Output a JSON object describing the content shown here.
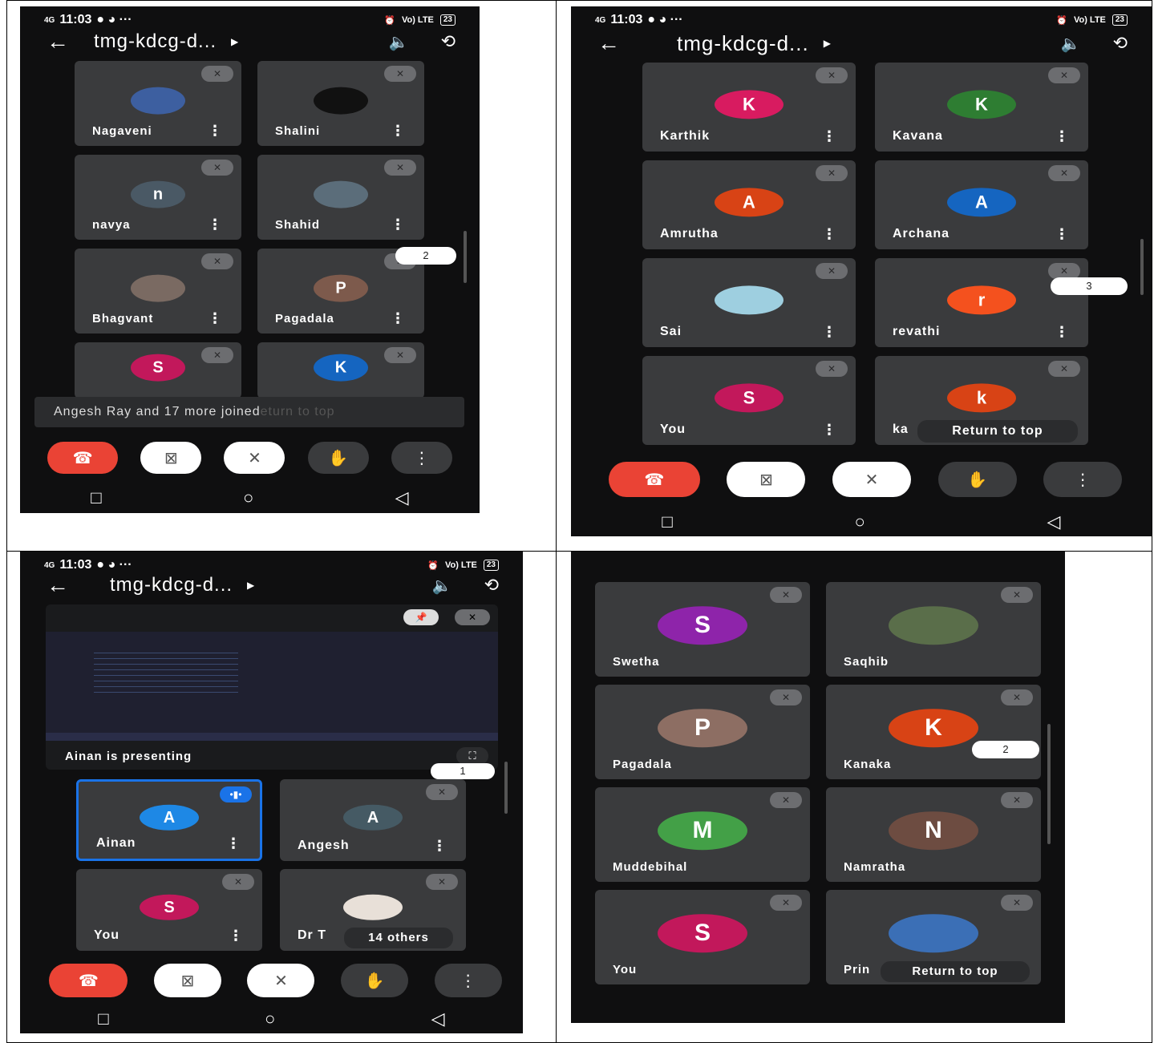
{
  "status": {
    "time": "11:03",
    "network": "4G",
    "lte": "Vo) LTE",
    "battery": "23"
  },
  "meeting_code": "tmg-kdcg-d...",
  "controls": {
    "more": "⋮"
  },
  "nav": {
    "recent": "□",
    "home": "○",
    "back": "◁"
  },
  "panel1": {
    "tiles": [
      {
        "name": "Nagaveni",
        "avatar": "",
        "color": "#3d5fa0",
        "photo": true
      },
      {
        "name": "Shalini",
        "avatar": "",
        "color": "#111",
        "photo": true
      },
      {
        "name": "navya",
        "avatar": "n",
        "color": "#4a5965"
      },
      {
        "name": "Shahid",
        "avatar": "",
        "color": "#5b6d7a",
        "photo": true
      },
      {
        "name": "Bhagvant",
        "avatar": "",
        "color": "#7a6a62",
        "photo": true
      },
      {
        "name": "Pagadala",
        "avatar": "P",
        "color": "#7d5a4c"
      },
      {
        "name": "",
        "avatar": "S",
        "color": "#c2185b"
      },
      {
        "name": "",
        "avatar": "K",
        "color": "#1565c0"
      }
    ],
    "page": "2",
    "toast": "Angesh Ray and 17 more joined",
    "toast_ghost": "eturn to top"
  },
  "panel2": {
    "tiles": [
      {
        "name": "Karthik",
        "avatar": "K",
        "color": "#d81b60"
      },
      {
        "name": "Kavana",
        "avatar": "K",
        "color": "#2e7d32"
      },
      {
        "name": "Amrutha",
        "avatar": "A",
        "color": "#d84315"
      },
      {
        "name": "Archana",
        "avatar": "A",
        "color": "#1565c0"
      },
      {
        "name": "Sai",
        "avatar": "",
        "color": "#9ecfe0",
        "photo": true
      },
      {
        "name": "revathi",
        "avatar": "r",
        "color": "#f4511e"
      },
      {
        "name": "You",
        "avatar": "S",
        "color": "#c2185b"
      },
      {
        "name": "ka",
        "avatar": "k",
        "color": "#d84315"
      }
    ],
    "page": "3",
    "return_to_top": "Return to top"
  },
  "panel3": {
    "presenting": "Ainan is presenting",
    "page": "1",
    "tiles": [
      {
        "name": "Ainan",
        "avatar": "A",
        "color": "#1e88e5",
        "active": true
      },
      {
        "name": "Angesh",
        "avatar": "A",
        "color": "#455a64"
      },
      {
        "name": "You",
        "avatar": "S",
        "color": "#c2185b"
      },
      {
        "name": "Dr T",
        "avatar": "",
        "color": "#e8e0d8",
        "photo": true
      }
    ],
    "others": "14 others"
  },
  "panel4": {
    "tiles": [
      {
        "name": "Swetha",
        "avatar": "S",
        "color": "#8e24aa"
      },
      {
        "name": "Saqhib",
        "avatar": "",
        "color": "#5a6e4a",
        "photo": true
      },
      {
        "name": "Pagadala",
        "avatar": "P",
        "color": "#8d6e63"
      },
      {
        "name": "Kanaka",
        "avatar": "K",
        "color": "#d84315"
      },
      {
        "name": "Muddebihal",
        "avatar": "M",
        "color": "#43a047"
      },
      {
        "name": "Namratha",
        "avatar": "N",
        "color": "#6d4c41"
      },
      {
        "name": "You",
        "avatar": "S",
        "color": "#c2185b"
      },
      {
        "name": "Prin",
        "avatar": "",
        "color": "#3b6fb6",
        "photo": true
      }
    ],
    "page": "2",
    "return_to_top": "Return to top"
  }
}
